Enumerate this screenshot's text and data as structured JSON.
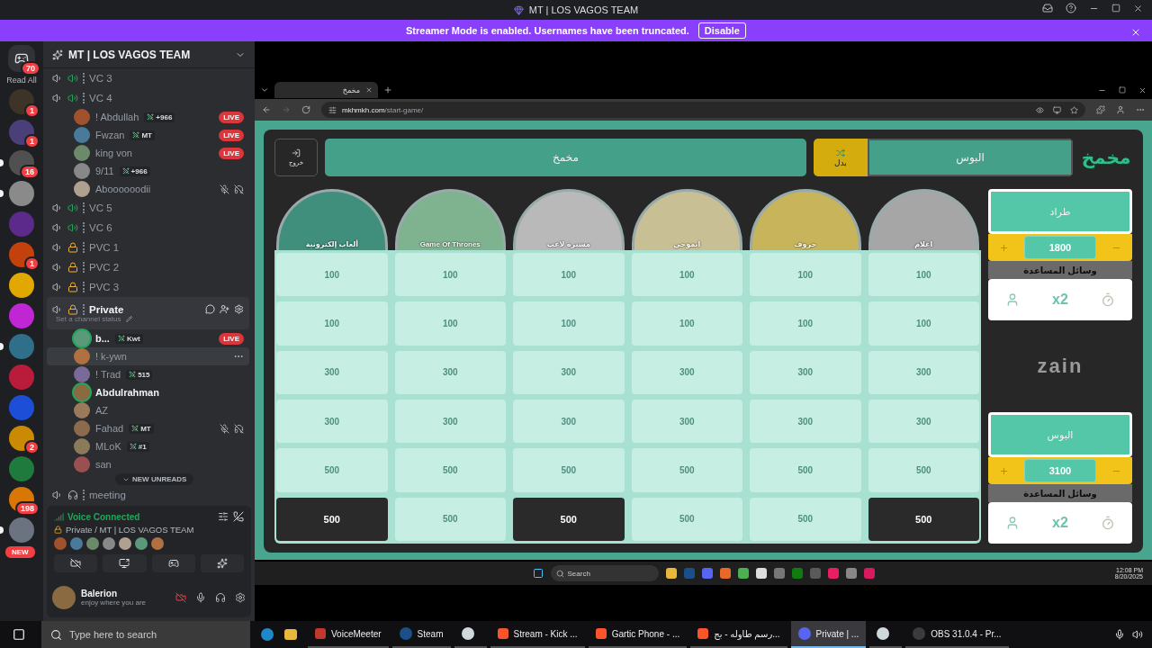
{
  "window": {
    "title": "MT | LOS VAGOS TEAM"
  },
  "banner": {
    "text": "Streamer Mode is enabled. Usernames have been truncated.",
    "button": "Disable"
  },
  "server_rail": {
    "home_badge": "70",
    "read_all": "Read All",
    "servers": [
      {
        "color": "#3d3326",
        "badge": "1",
        "unread": false
      },
      {
        "color": "#4b3f7a",
        "badge": "1",
        "unread": false
      },
      {
        "color": "#505050",
        "badge": "16",
        "unread": true
      },
      {
        "color": "#8a8a8a",
        "unread": true
      },
      {
        "color": "#5b2a8a",
        "unread": false
      },
      {
        "color": "#c2410c",
        "badge": "1",
        "unread": false
      },
      {
        "color": "#e0a800",
        "unread": false
      },
      {
        "color": "#c026d3",
        "unread": false
      },
      {
        "color": "#2f6f8a",
        "unread": true
      },
      {
        "color": "#b91c3a",
        "unread": false
      },
      {
        "color": "#1d4ed8",
        "unread": false
      },
      {
        "color": "#ca8a04",
        "badge": "2",
        "unread": false
      },
      {
        "color": "#1f7a3d",
        "unread": false
      },
      {
        "color": "#d97706",
        "badge": "198",
        "unread": false
      },
      {
        "color": "#6b7280",
        "badge": "NEW",
        "unread": true
      }
    ]
  },
  "server": {
    "name": "MT | LOS VAGOS TEAM"
  },
  "channels": [
    {
      "kind": "voice",
      "name": "VC 3",
      "selected": false
    },
    {
      "kind": "voice",
      "name": "VC 4",
      "selected": false,
      "members": [
        {
          "name": "! Abdullah",
          "tag": "+966",
          "badge": "LIVE",
          "speaking": false,
          "muted": false,
          "hovered": false
        },
        {
          "name": "Fwzan",
          "tag": "MT",
          "badge": "LIVE",
          "speaking": false,
          "muted": false,
          "hovered": false
        },
        {
          "name": "king von",
          "badge": "LIVE",
          "speaking": false,
          "muted": false,
          "hovered": false
        },
        {
          "name": "9/11",
          "tag": "+966",
          "speaking": false,
          "muted": false,
          "hovered": false
        },
        {
          "name": "Aboooooodii",
          "speaking": false,
          "muted": true,
          "hovered": false
        }
      ]
    },
    {
      "kind": "voice",
      "name": "VC 5",
      "selected": false
    },
    {
      "kind": "voice",
      "name": "VC 6",
      "selected": false
    },
    {
      "kind": "locked",
      "name": "PVC 1",
      "selected": false
    },
    {
      "kind": "locked",
      "name": "PVC 2",
      "selected": false
    },
    {
      "kind": "locked",
      "name": "PVC 3",
      "selected": false
    },
    {
      "kind": "locked",
      "name": "Private",
      "selected": true,
      "status": "Set a channel status",
      "members": [
        {
          "name": "b...",
          "tag": "Kwt",
          "badge": "LIVE",
          "speaking": true,
          "muted": false,
          "hovered": false
        },
        {
          "name": "! k-ywn",
          "speaking": false,
          "muted": false,
          "hovered": true
        },
        {
          "name": "! Trad",
          "tag": "515",
          "speaking": false,
          "muted": false,
          "hovered": false
        },
        {
          "name": "Abdulrahman",
          "speaking": true,
          "muted": false,
          "hovered": false
        },
        {
          "name": "AZ",
          "speaking": false,
          "muted": false,
          "hovered": false
        },
        {
          "name": "Fahad",
          "tag": "MT",
          "speaking": false,
          "muted": true,
          "hovered": false
        },
        {
          "name": "MLoK",
          "tag": "#1",
          "speaking": false,
          "muted": false,
          "hovered": false
        },
        {
          "name": "san",
          "speaking": false,
          "muted": false,
          "hovered": false
        }
      ]
    },
    {
      "kind": "audio",
      "name": "meeting",
      "selected": false
    }
  ],
  "new_unreads": "NEW UNREADS",
  "voice_panel": {
    "status": "Voice Connected",
    "channel": "Private / MT | LOS VAGOS TEAM"
  },
  "user_panel": {
    "name": "Balerion",
    "status": "enjoy where you are"
  },
  "browser": {
    "tabs": [
      {
        "title": "مخمخ",
        "selected": true
      }
    ],
    "url_host": "mkhmkh.com",
    "url_path": "/start-game/"
  },
  "game": {
    "exit_label": "خروج",
    "team_a": "مخمخ",
    "team_b": "البوس",
    "swap_label": "بدل",
    "logo": "مخمخ",
    "categories": [
      {
        "title": "اعلام",
        "color": "#a6a6a6",
        "cells": [
          {
            "points": "100",
            "available": false
          },
          {
            "points": "100",
            "available": false
          },
          {
            "points": "300",
            "available": false
          },
          {
            "points": "300",
            "available": false
          },
          {
            "points": "500",
            "available": false
          },
          {
            "points": "500",
            "available": true
          }
        ]
      },
      {
        "title": "حروف",
        "color": "#c8b45a",
        "cells": [
          {
            "points": "100",
            "available": false
          },
          {
            "points": "100",
            "available": false
          },
          {
            "points": "300",
            "available": false
          },
          {
            "points": "300",
            "available": false
          },
          {
            "points": "500",
            "available": false
          },
          {
            "points": "500",
            "available": false
          }
        ]
      },
      {
        "title": "ايموجي",
        "color": "#c9bf95",
        "cells": [
          {
            "points": "100",
            "available": false
          },
          {
            "points": "100",
            "available": false
          },
          {
            "points": "300",
            "available": false
          },
          {
            "points": "300",
            "available": false
          },
          {
            "points": "500",
            "available": false
          },
          {
            "points": "500",
            "available": false
          }
        ]
      },
      {
        "title": "مسيرة لاعب",
        "color": "#b9b9b9",
        "cells": [
          {
            "points": "100",
            "available": false
          },
          {
            "points": "100",
            "available": false
          },
          {
            "points": "300",
            "available": false
          },
          {
            "points": "300",
            "available": false
          },
          {
            "points": "500",
            "available": false
          },
          {
            "points": "500",
            "available": true
          }
        ]
      },
      {
        "title": "Game Of Thrones",
        "color": "#7fb28f",
        "cells": [
          {
            "points": "100",
            "available": false
          },
          {
            "points": "100",
            "available": false
          },
          {
            "points": "300",
            "available": false
          },
          {
            "points": "300",
            "available": false
          },
          {
            "points": "500",
            "available": false
          },
          {
            "points": "500",
            "available": false
          }
        ]
      },
      {
        "title": "ألعاب إلكترونية",
        "color": "#3f8f7c",
        "cells": [
          {
            "points": "100",
            "available": false
          },
          {
            "points": "100",
            "available": false
          },
          {
            "points": "300",
            "available": false
          },
          {
            "points": "300",
            "available": false
          },
          {
            "points": "500",
            "available": false
          },
          {
            "points": "500",
            "available": true
          }
        ]
      }
    ],
    "teams": [
      {
        "name": "طراد",
        "score": "1800",
        "helpers_title": "وسائل المساعدة",
        "double_label": "x2"
      },
      {
        "name": "البوس",
        "score": "3100",
        "helpers_title": "وسائل المساعدة",
        "double_label": "x2"
      }
    ],
    "sponsor": "zain"
  },
  "inner_taskbar": {
    "search": "Search",
    "time": "12:08 PM",
    "date": "8/20/2025"
  },
  "taskbar": {
    "search_placeholder": "Type here to search",
    "apps": [
      {
        "kind": "voicemeeter",
        "label": "VoiceMeeter",
        "selected": false
      },
      {
        "kind": "steam",
        "label": "Steam",
        "selected": false
      },
      {
        "kind": "ring",
        "selected": false
      },
      {
        "kind": "brave",
        "label": "Stream - Kick ...",
        "selected": false
      },
      {
        "kind": "brave",
        "label": "Gartic Phone - ...",
        "selected": false
      },
      {
        "kind": "brave",
        "label": "رسم طاوله - بج...",
        "selected": false
      },
      {
        "kind": "discord",
        "label": "Private | ...",
        "selected": true
      },
      {
        "kind": "ring",
        "selected": false
      },
      {
        "kind": "obs",
        "label": "OBS 31.0.4 - Pr...",
        "selected": false
      }
    ]
  }
}
